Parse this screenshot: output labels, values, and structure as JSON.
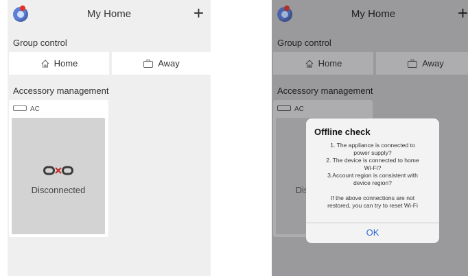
{
  "screens": [
    {
      "header": {
        "title": "My Home",
        "add_label": "+"
      },
      "group_control": {
        "title": "Group control",
        "home": "Home",
        "away": "Away"
      },
      "accessory": {
        "title": "Accessory management",
        "device_label": "AC",
        "status": "Disconnected"
      }
    },
    {
      "header": {
        "title": "My Home",
        "add_label": "+"
      },
      "group_control": {
        "title": "Group control",
        "home": "Home",
        "away": "Away"
      },
      "accessory": {
        "title": "Accessory management",
        "device_label": "AC",
        "status": "Disconnected"
      },
      "dialog": {
        "title": "Offline check",
        "lines": [
          "1. The appliance is connected to",
          "power supply?",
          "2. The device is connected to home",
          "Wi-Fi?",
          "3.Account region is consistent with",
          "device region?",
          "If the above connections are not",
          "restored, you can try to reset Wi-Fi"
        ],
        "ok_label": "OK"
      }
    }
  ],
  "icons": {
    "avatar": "app-avatar-icon",
    "add": "plus-icon",
    "home": "house-icon",
    "away": "suitcase-icon",
    "device": "ac-unit-icon",
    "disconnected": "broken-link-icon"
  },
  "colors": {
    "accent": "#2f6bd6",
    "badge": "#e2322b",
    "avatar": "#5f7fd6"
  }
}
